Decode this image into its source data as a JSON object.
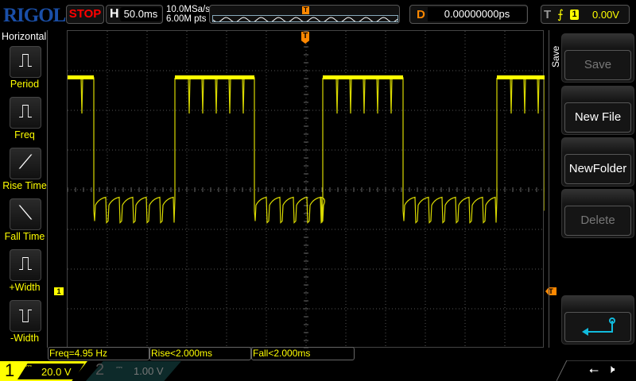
{
  "header": {
    "logo": "RIGOL",
    "run_state": "STOP",
    "h_label": "H",
    "timebase": "50.0ms",
    "sample_rate": "10.0MSa/s",
    "mem_depth": "6.00M pts",
    "delay_label": "D",
    "delay": "0.00000000ps",
    "trig_label": "T",
    "trig_source": "1",
    "trig_level": "0.00V"
  },
  "left_menu": {
    "title": "Horizontal",
    "items": [
      {
        "label": "Period"
      },
      {
        "label": "Freq"
      },
      {
        "label": "Rise Time"
      },
      {
        "label": "Fall Time"
      },
      {
        "label": "+Width"
      },
      {
        "label": "-Width"
      }
    ]
  },
  "right_menu": {
    "title": "Save",
    "buttons": [
      {
        "label": "Save",
        "enabled": false
      },
      {
        "label": "New File",
        "enabled": true
      },
      {
        "label": "NewFolder",
        "enabled": true
      },
      {
        "label": "Delete",
        "enabled": false
      }
    ]
  },
  "measurements": [
    "Freq=4.95 Hz",
    "Rise<2.000ms",
    "Fall<2.000ms"
  ],
  "channels": [
    {
      "num": "1",
      "scale": "20.0 V",
      "active": true
    },
    {
      "num": "2",
      "scale": "1.00 V",
      "active": false
    }
  ],
  "markers": {
    "ch1": "1",
    "trigger": "T"
  },
  "colors": {
    "ch1": "#ffff00",
    "trigger": "#ff8000",
    "logo": "#1a4fa8",
    "stop": "#ff0000"
  },
  "waveform": {
    "time_per_div_ms": 50,
    "volts_per_div": 20,
    "high_v": 108,
    "low_v": 47,
    "transitions_ms": [
      -267,
      -165,
      -65,
      21,
      122,
      240
    ],
    "start_level": "high"
  }
}
